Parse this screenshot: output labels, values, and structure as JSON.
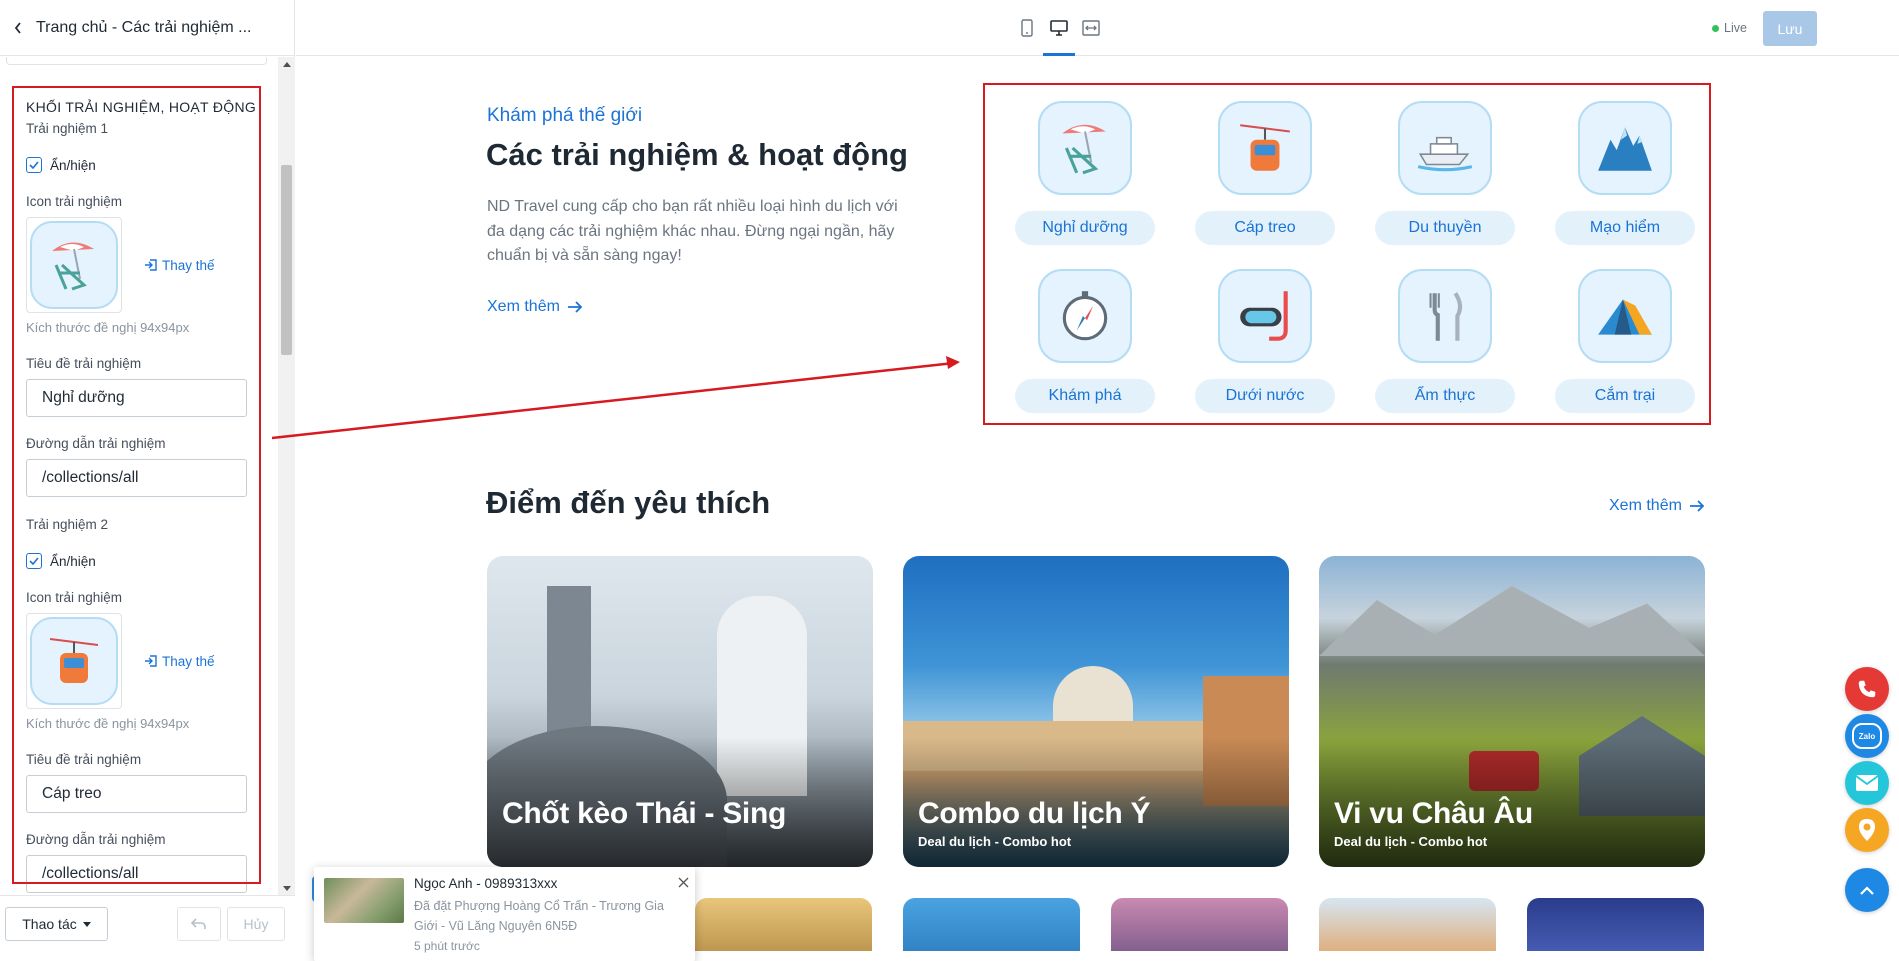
{
  "editor": {
    "back_title": "Trang chủ - Các trải nghiệm ...",
    "group_title": "KHỐI TRẢI NGHIỆM, HOẠT ĐỘNG",
    "items": [
      {
        "label": "Trải nghiệm 1",
        "toggle_label": "Ẩn/hiện",
        "icon_label": "Icon trải nghiệm",
        "replace_label": "Thay thế",
        "size_hint": "Kích thước đề nghị 94x94px",
        "title_label": "Tiêu đề trải nghiệm",
        "title_value": "Nghỉ dưỡng",
        "link_label": "Đường dẫn trải nghiệm",
        "link_value": "/collections/all"
      },
      {
        "label": "Trải nghiệm 2",
        "toggle_label": "Ẩn/hiện",
        "icon_label": "Icon trải nghiệm",
        "replace_label": "Thay thế",
        "size_hint": "Kích thước đề nghị 94x94px",
        "title_label": "Tiêu đề trải nghiệm",
        "title_value": "Cáp treo",
        "link_label": "Đường dẫn trải nghiệm",
        "link_value": "/collections/all"
      }
    ],
    "footer": {
      "actions_label": "Thao tác",
      "redo_label": "Hủy"
    }
  },
  "topbar": {
    "live_label": "Live",
    "save_label": "Lưu"
  },
  "experiences": {
    "eyebrow": "Khám phá thế giới",
    "title": "Các trải nghiệm & hoạt động",
    "description": "ND Travel cung cấp cho bạn rất nhiều loại hình du lịch với đa dạng các trải nghiệm khác nhau. Đừng ngại ngần, hãy chuẩn bị và sẵn sàng ngay!",
    "more_label": "Xem thêm",
    "items": [
      {
        "name": "Nghỉ dưỡng",
        "icon": "beach-chair-icon"
      },
      {
        "name": "Cáp treo",
        "icon": "cable-car-icon"
      },
      {
        "name": "Du thuyền",
        "icon": "yacht-icon"
      },
      {
        "name": "Mạo hiểm",
        "icon": "mountain-icon"
      },
      {
        "name": "Khám phá",
        "icon": "compass-icon"
      },
      {
        "name": "Dưới nước",
        "icon": "snorkel-mask-icon"
      },
      {
        "name": "Ẩm thực",
        "icon": "cutlery-icon"
      },
      {
        "name": "Cắm trại",
        "icon": "tent-icon"
      }
    ]
  },
  "destinations": {
    "title": "Điểm đến yêu thích",
    "more_label": "Xem thêm",
    "cards": [
      {
        "name": "Chốt kèo Thái - Sing",
        "subtitle": ""
      },
      {
        "name": "Combo du lịch Ý",
        "subtitle": "Deal du lịch - Combo hot"
      },
      {
        "name": "Vi vu Châu Âu",
        "subtitle": "Deal du lịch - Combo hot"
      }
    ]
  },
  "notification": {
    "name": "Ngọc Anh - 0989313xxx",
    "message": "Đã đặt Phượng Hoàng Cổ Trấn - Trương Gia Giới - Vũ Lăng Nguyên 6N5Đ",
    "time": "5 phút trước"
  },
  "colors": {
    "accent": "#1b73d6",
    "annotation": "#d71920",
    "phone": "#e53935",
    "zalo": "#1e88e5",
    "mail": "#26c6da",
    "map": "#f5a623",
    "top": "#1e88e5"
  }
}
